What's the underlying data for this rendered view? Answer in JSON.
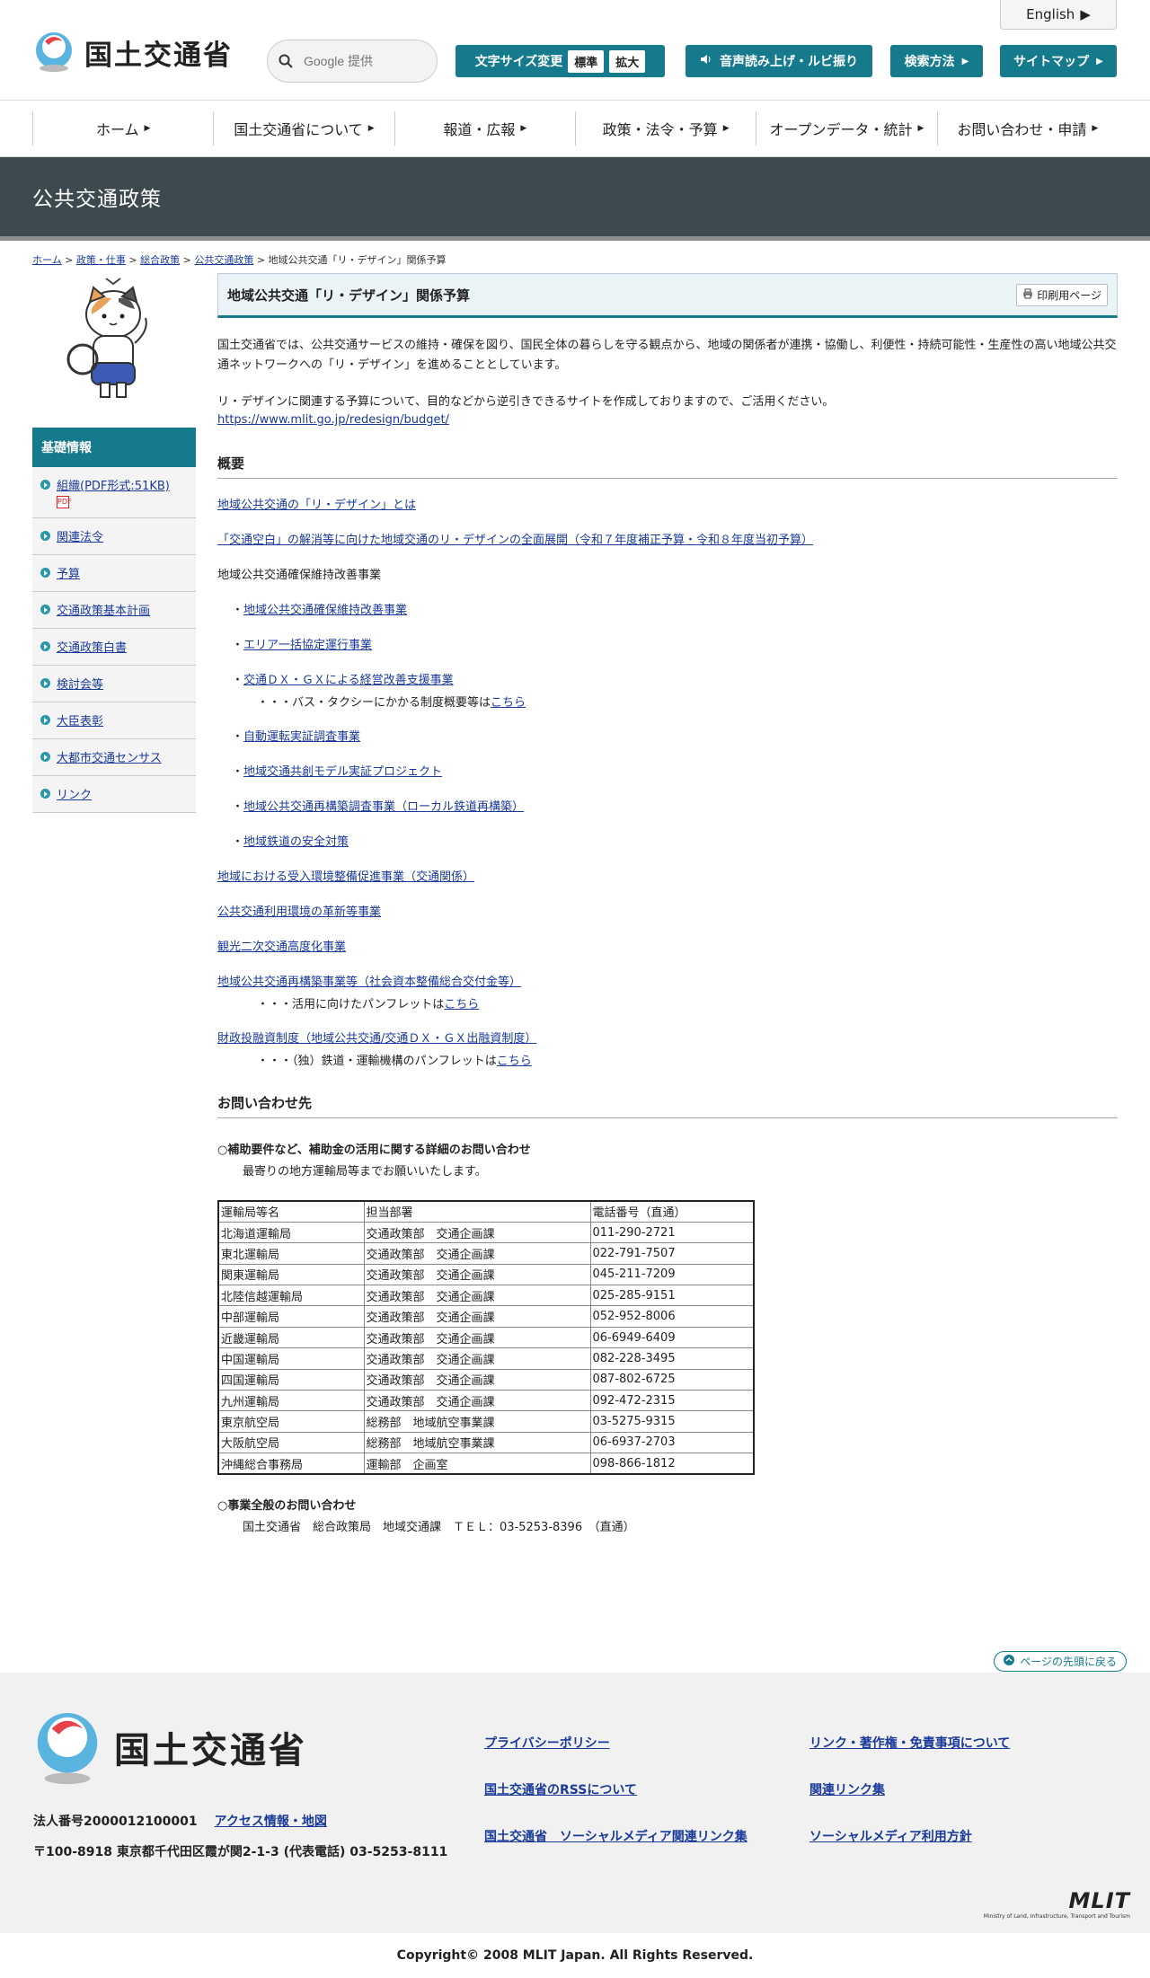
{
  "header": {
    "logo_text": "国土交通省",
    "english": "English",
    "search_placeholder": "Google 提供",
    "fontsize_label": "文字サイズ変更",
    "fontsize_standard": "標準",
    "fontsize_large": "拡大",
    "read_aloud": "音声読み上げ・ルビ振り",
    "search_method": "検索方法",
    "sitemap": "サイトマップ"
  },
  "gnav": [
    "ホーム",
    "国土交通省について",
    "報道・広報",
    "政策・法令・予算",
    "オープンデータ・統計",
    "お問い合わせ・申請"
  ],
  "page_title": "公共交通政策",
  "breadcrumb": {
    "items": [
      "ホーム",
      "政策・仕事",
      "総合政策",
      "公共交通政策"
    ],
    "sep": ">",
    "current": "地域公共交通「リ・デザイン」関係予算"
  },
  "sidebar": {
    "heading": "基礎情報",
    "items": [
      "組織(PDF形式:51KB)",
      "関連法令",
      "予算",
      "交通政策基本計画",
      "交通政策白書",
      "検討会等",
      "大臣表彰",
      "大都市交通センサス",
      "リンク"
    ]
  },
  "main": {
    "heading": "地域公共交通「リ・デザイン」関係予算",
    "print": "印刷用ページ",
    "intro1": "国土交通省では、公共交通サービスの維持・確保を図り、国民全体の暮らしを守る観点から、地域の関係者が連携・協働し、利便性・持続可能性・生産性の高い地域公共交通ネットワークへの「リ・デザイン」を進めることとしています。",
    "intro2": "リ・デザインに関連する予算について、目的などから逆引きできるサイトを作成しておりますので、ご活用ください。",
    "intro_link": "https://www.mlit.go.jp/redesign/budget/",
    "overview_heading": "概要",
    "links": {
      "l1": "地域公共交通の「リ・デザイン」とは",
      "l2": "「交通空白」の解消等に向けた地域交通のリ・デザインの全面展開（令和７年度補正予算・令和８年度当初予算）",
      "l3_plain": "地域公共交通確保維持改善事業",
      "bullet": "・",
      "sub1": "地域公共交通確保維持改善事業",
      "sub2": "エリア一括協定運行事業",
      "sub3": "交通ＤＸ・ＧＸによる経営改善支援事業",
      "sub3_note": "・・・バス・タクシーにかかる制度概要等は",
      "sub3_note_link": "こちら",
      "sub4": "自動運転実証調査事業",
      "sub5": "地域交通共創モデル実証プロジェクト",
      "sub6": "地域公共交通再構築調査事業（ローカル鉄道再構築）",
      "sub7": "地域鉄道の安全対策",
      "l4": "地域における受入環境整備促進事業（交通関係）",
      "l5": "公共交通利用環境の革新等事業",
      "l6": "観光二次交通高度化事業",
      "l7": "地域公共交通再構築事業等（社会資本整備総合交付金等）",
      "l7_note": "・・・活用に向けたパンフレットは",
      "l7_note_link": "こちら",
      "l8": "財政投融資制度（地域公共交通/交通ＤＸ・ＧＸ出融資制度）",
      "l8_note": "・・・（独）鉄道・運輸機構のパンフレットは",
      "l8_note_link": "こちら"
    },
    "contact_heading": "お問い合わせ先",
    "contact_sub1": "○補助要件など、補助金の活用に関する詳細のお問い合わせ",
    "contact_note1": "最寄りの地方運輸局等までお願いいたします。",
    "table": {
      "headers": [
        "運輸局等名",
        "担当部署",
        "電話番号（直通）"
      ],
      "rows": [
        [
          "北海道運輸局",
          "交通政策部　交通企画課",
          "011-290-2721"
        ],
        [
          "東北運輸局",
          "交通政策部　交通企画課",
          "022-791-7507"
        ],
        [
          "関東運輸局",
          "交通政策部　交通企画課",
          "045-211-7209"
        ],
        [
          "北陸信越運輸局",
          "交通政策部　交通企画課",
          "025-285-9151"
        ],
        [
          "中部運輸局",
          "交通政策部　交通企画課",
          "052-952-8006"
        ],
        [
          "近畿運輸局",
          "交通政策部　交通企画課",
          "06-6949-6409"
        ],
        [
          "中国運輸局",
          "交通政策部　交通企画課",
          "082-228-3495"
        ],
        [
          "四国運輸局",
          "交通政策部　交通企画課",
          "087-802-6725"
        ],
        [
          "九州運輸局",
          "交通政策部　交通企画課",
          "092-472-2315"
        ],
        [
          "東京航空局",
          "総務部　地域航空事業課",
          "03-5275-9315"
        ],
        [
          "大阪航空局",
          "総務部　地域航空事業課",
          "06-6937-2703"
        ],
        [
          "沖縄総合事務局",
          "運輸部　企画室",
          "098-866-1812"
        ]
      ]
    },
    "contact_sub2": "○事業全般のお問い合わせ",
    "contact_note2": "国土交通省　総合政策局　地域交通課　ＴＥＬ：03-5253-8396　（直通）"
  },
  "pagetop": "ページの先頭に戻る",
  "footer": {
    "logo_text": "国土交通省",
    "corp_no": "法人番号2000012100001",
    "access": "アクセス情報・地図",
    "address": "〒100-8918 東京都千代田区霞が関2-1-3 (代表電話) 03-5253-8111",
    "links": [
      "プライバシーポリシー",
      "リンク・著作権・免責事項について",
      "国土交通省のRSSについて",
      "関連リンク集",
      "国土交通省　ソーシャルメディア関連リンク集",
      "ソーシャルメディア利用方針"
    ],
    "mlit": "MLIT",
    "mlit_sub": "Ministry of Land, Infrastructure, Transport and Tourism",
    "copyright": "Copyright© 2008 MLIT Japan. All Rights Reserved."
  },
  "colors": {
    "accent": "#157b8c",
    "title_band": "#3c4a50",
    "link": "#1a3a9a"
  }
}
